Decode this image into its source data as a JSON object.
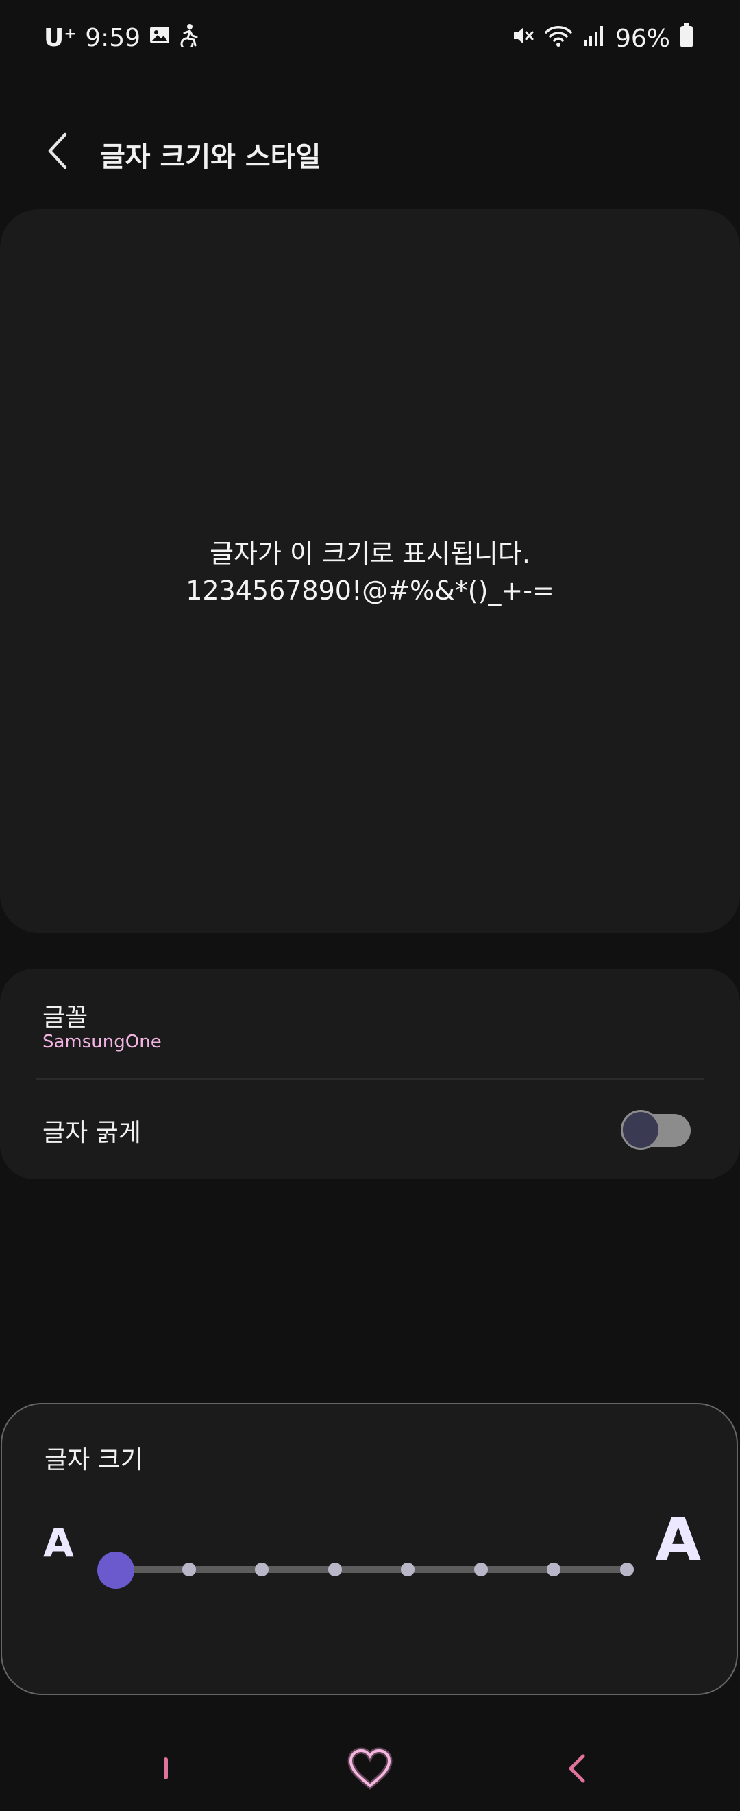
{
  "status_bar": {
    "carrier": "U⁺",
    "time": "9:59",
    "battery": "96%",
    "icons": [
      "gallery-icon",
      "accessibility-icon",
      "mute-icon",
      "wifi-icon",
      "signal-icon",
      "battery-icon"
    ]
  },
  "header": {
    "back_icon": "chevron-left-icon",
    "title": "글자 크기와 스타일"
  },
  "preview": {
    "line1": "글자가 이 크기로 표시됩니다.",
    "line2": "1234567890!@#%&*()_+-="
  },
  "settings": {
    "font_title": "글꼴",
    "font_value": "SamsungOne",
    "bold_title": "글자 굵게",
    "bold_enabled": false
  },
  "font_size": {
    "title": "글자 크기",
    "min_label": "A",
    "max_label": "A",
    "levels": 8,
    "current_level": 1
  },
  "nav_bar": {
    "icons": [
      "recents-icon",
      "home-icon",
      "back-icon"
    ]
  },
  "colors": {
    "background": "#111111",
    "card": "#1b1b1b",
    "accent": "#6a5acd",
    "font_value": "#f2b4e2",
    "nav_icon": "#e0739b"
  }
}
